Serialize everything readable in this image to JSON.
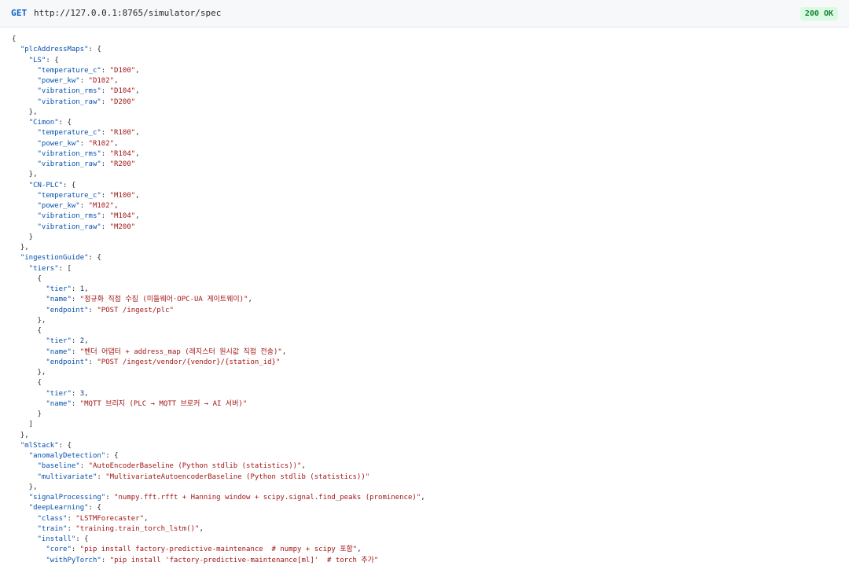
{
  "request": {
    "method": "GET",
    "url": "http://127.0.0.1:8765/simulator/spec",
    "status": "200 OK"
  },
  "lines": [
    [
      [
        "{",
        "p"
      ]
    ],
    [
      [
        "  ",
        "p"
      ],
      [
        "\"plcAddressMaps\"",
        "k"
      ],
      [
        ": {",
        "p"
      ]
    ],
    [
      [
        "    ",
        "p"
      ],
      [
        "\"LS\"",
        "k"
      ],
      [
        ": {",
        "p"
      ]
    ],
    [
      [
        "      ",
        "p"
      ],
      [
        "\"temperature_c\"",
        "k"
      ],
      [
        ": ",
        "p"
      ],
      [
        "\"D100\"",
        "s"
      ],
      [
        ",",
        "p"
      ]
    ],
    [
      [
        "      ",
        "p"
      ],
      [
        "\"power_kw\"",
        "k"
      ],
      [
        ": ",
        "p"
      ],
      [
        "\"D102\"",
        "s"
      ],
      [
        ",",
        "p"
      ]
    ],
    [
      [
        "      ",
        "p"
      ],
      [
        "\"vibration_rms\"",
        "k"
      ],
      [
        ": ",
        "p"
      ],
      [
        "\"D104\"",
        "s"
      ],
      [
        ",",
        "p"
      ]
    ],
    [
      [
        "      ",
        "p"
      ],
      [
        "\"vibration_raw\"",
        "k"
      ],
      [
        ": ",
        "p"
      ],
      [
        "\"D200\"",
        "s"
      ]
    ],
    [
      [
        "    },",
        "p"
      ]
    ],
    [
      [
        "    ",
        "p"
      ],
      [
        "\"Cimon\"",
        "k"
      ],
      [
        ": {",
        "p"
      ]
    ],
    [
      [
        "      ",
        "p"
      ],
      [
        "\"temperature_c\"",
        "k"
      ],
      [
        ": ",
        "p"
      ],
      [
        "\"R100\"",
        "s"
      ],
      [
        ",",
        "p"
      ]
    ],
    [
      [
        "      ",
        "p"
      ],
      [
        "\"power_kw\"",
        "k"
      ],
      [
        ": ",
        "p"
      ],
      [
        "\"R102\"",
        "s"
      ],
      [
        ",",
        "p"
      ]
    ],
    [
      [
        "      ",
        "p"
      ],
      [
        "\"vibration_rms\"",
        "k"
      ],
      [
        ": ",
        "p"
      ],
      [
        "\"R104\"",
        "s"
      ],
      [
        ",",
        "p"
      ]
    ],
    [
      [
        "      ",
        "p"
      ],
      [
        "\"vibration_raw\"",
        "k"
      ],
      [
        ": ",
        "p"
      ],
      [
        "\"R200\"",
        "s"
      ]
    ],
    [
      [
        "    },",
        "p"
      ]
    ],
    [
      [
        "    ",
        "p"
      ],
      [
        "\"CN-PLC\"",
        "k"
      ],
      [
        ": {",
        "p"
      ]
    ],
    [
      [
        "      ",
        "p"
      ],
      [
        "\"temperature_c\"",
        "k"
      ],
      [
        ": ",
        "p"
      ],
      [
        "\"M100\"",
        "s"
      ],
      [
        ",",
        "p"
      ]
    ],
    [
      [
        "      ",
        "p"
      ],
      [
        "\"power_kw\"",
        "k"
      ],
      [
        ": ",
        "p"
      ],
      [
        "\"M102\"",
        "s"
      ],
      [
        ",",
        "p"
      ]
    ],
    [
      [
        "      ",
        "p"
      ],
      [
        "\"vibration_rms\"",
        "k"
      ],
      [
        ": ",
        "p"
      ],
      [
        "\"M104\"",
        "s"
      ],
      [
        ",",
        "p"
      ]
    ],
    [
      [
        "      ",
        "p"
      ],
      [
        "\"vibration_raw\"",
        "k"
      ],
      [
        ": ",
        "p"
      ],
      [
        "\"M200\"",
        "s"
      ]
    ],
    [
      [
        "    }",
        "p"
      ]
    ],
    [
      [
        "  },",
        "p"
      ]
    ],
    [
      [
        "  ",
        "p"
      ],
      [
        "\"ingestionGuide\"",
        "k"
      ],
      [
        ": {",
        "p"
      ]
    ],
    [
      [
        "    ",
        "p"
      ],
      [
        "\"tiers\"",
        "k"
      ],
      [
        ": [",
        "p"
      ]
    ],
    [
      [
        "      {",
        "p"
      ]
    ],
    [
      [
        "        ",
        "p"
      ],
      [
        "\"tier\"",
        "k"
      ],
      [
        ": ",
        "p"
      ],
      [
        "1",
        "n"
      ],
      [
        ",",
        "p"
      ]
    ],
    [
      [
        "        ",
        "p"
      ],
      [
        "\"name\"",
        "k"
      ],
      [
        ": ",
        "p"
      ],
      [
        "\"정규화 직접 수집 (미들웨어·OPC-UA 게이트웨이)\"",
        "s"
      ],
      [
        ",",
        "p"
      ]
    ],
    [
      [
        "        ",
        "p"
      ],
      [
        "\"endpoint\"",
        "k"
      ],
      [
        ": ",
        "p"
      ],
      [
        "\"POST /ingest/plc\"",
        "s"
      ]
    ],
    [
      [
        "      },",
        "p"
      ]
    ],
    [
      [
        "      {",
        "p"
      ]
    ],
    [
      [
        "        ",
        "p"
      ],
      [
        "\"tier\"",
        "k"
      ],
      [
        ": ",
        "p"
      ],
      [
        "2",
        "n"
      ],
      [
        ",",
        "p"
      ]
    ],
    [
      [
        "        ",
        "p"
      ],
      [
        "\"name\"",
        "k"
      ],
      [
        ": ",
        "p"
      ],
      [
        "\"벤더 어댑터 + address_map (레지스터 원시값 직접 전송)\"",
        "s"
      ],
      [
        ",",
        "p"
      ]
    ],
    [
      [
        "        ",
        "p"
      ],
      [
        "\"endpoint\"",
        "k"
      ],
      [
        ": ",
        "p"
      ],
      [
        "\"POST /ingest/vendor/{vendor}/{station_id}\"",
        "s"
      ]
    ],
    [
      [
        "      },",
        "p"
      ]
    ],
    [
      [
        "      {",
        "p"
      ]
    ],
    [
      [
        "        ",
        "p"
      ],
      [
        "\"tier\"",
        "k"
      ],
      [
        ": ",
        "p"
      ],
      [
        "3",
        "n"
      ],
      [
        ",",
        "p"
      ]
    ],
    [
      [
        "        ",
        "p"
      ],
      [
        "\"name\"",
        "k"
      ],
      [
        ": ",
        "p"
      ],
      [
        "\"MQTT 브리지 (PLC → MQTT 브로커 → AI 서버)\"",
        "s"
      ]
    ],
    [
      [
        "      }",
        "p"
      ]
    ],
    [
      [
        "    ]",
        "p"
      ]
    ],
    [
      [
        "  },",
        "p"
      ]
    ],
    [
      [
        "  ",
        "p"
      ],
      [
        "\"mlStack\"",
        "k"
      ],
      [
        ": {",
        "p"
      ]
    ],
    [
      [
        "    ",
        "p"
      ],
      [
        "\"anomalyDetection\"",
        "k"
      ],
      [
        ": {",
        "p"
      ]
    ],
    [
      [
        "      ",
        "p"
      ],
      [
        "\"baseline\"",
        "k"
      ],
      [
        ": ",
        "p"
      ],
      [
        "\"AutoEncoderBaseline (Python stdlib (statistics))\"",
        "s"
      ],
      [
        ",",
        "p"
      ]
    ],
    [
      [
        "      ",
        "p"
      ],
      [
        "\"multivariate\"",
        "k"
      ],
      [
        ": ",
        "p"
      ],
      [
        "\"MultivariateAutoencoderBaseline (Python stdlib (statistics))\"",
        "s"
      ]
    ],
    [
      [
        "    },",
        "p"
      ]
    ],
    [
      [
        "    ",
        "p"
      ],
      [
        "\"signalProcessing\"",
        "k"
      ],
      [
        ": ",
        "p"
      ],
      [
        "\"numpy.fft.rfft + Hanning window + scipy.signal.find_peaks (prominence)\"",
        "s"
      ],
      [
        ",",
        "p"
      ]
    ],
    [
      [
        "    ",
        "p"
      ],
      [
        "\"deepLearning\"",
        "k"
      ],
      [
        ": {",
        "p"
      ]
    ],
    [
      [
        "      ",
        "p"
      ],
      [
        "\"class\"",
        "k"
      ],
      [
        ": ",
        "p"
      ],
      [
        "\"LSTMForecaster\"",
        "s"
      ],
      [
        ",",
        "p"
      ]
    ],
    [
      [
        "      ",
        "p"
      ],
      [
        "\"train\"",
        "k"
      ],
      [
        ": ",
        "p"
      ],
      [
        "\"training.train_torch_lstm()\"",
        "s"
      ],
      [
        ",",
        "p"
      ]
    ],
    [
      [
        "      ",
        "p"
      ],
      [
        "\"install\"",
        "k"
      ],
      [
        ": {",
        "p"
      ]
    ],
    [
      [
        "        ",
        "p"
      ],
      [
        "\"core\"",
        "k"
      ],
      [
        ": ",
        "p"
      ],
      [
        "\"pip install factory-predictive-maintenance  # numpy + scipy 포함\"",
        "s"
      ],
      [
        ",",
        "p"
      ]
    ],
    [
      [
        "        ",
        "p"
      ],
      [
        "\"withPyTorch\"",
        "k"
      ],
      [
        ": ",
        "p"
      ],
      [
        "\"pip install 'factory-predictive-maintenance[ml]'  # torch 추가\"",
        "s"
      ]
    ]
  ]
}
